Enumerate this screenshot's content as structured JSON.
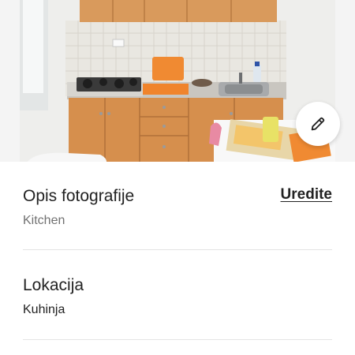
{
  "photo": {
    "alt": "Kitchen",
    "edit_icon": "pencil-icon"
  },
  "description": {
    "title": "Opis fotografije",
    "value": "Kitchen",
    "edit_label": "Uredite"
  },
  "location": {
    "title": "Lokacija",
    "value": "Kuhinja"
  },
  "colors": {
    "text_primary": "#222222",
    "text_secondary": "#717171",
    "divider": "#e4e4e4"
  }
}
